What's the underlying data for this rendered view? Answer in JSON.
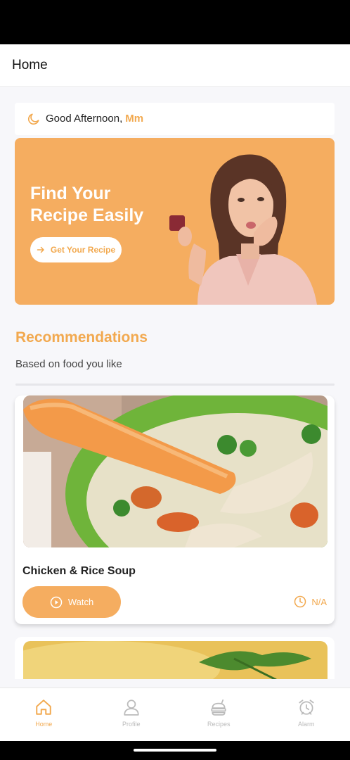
{
  "header": {
    "title": "Home"
  },
  "greeting": {
    "text": "Good Afternoon,",
    "name": "Mm"
  },
  "banner": {
    "title": "Find Your\n Recipe Easily",
    "button_label": "Get Your Recipe"
  },
  "recommendations": {
    "title": "Recommendations",
    "subtitle": "Based on food you like"
  },
  "recipes": [
    {
      "name": "Chicken & Rice Soup",
      "watch_label": "Watch",
      "time": "N/A"
    }
  ],
  "nav": [
    {
      "label": "Home",
      "icon": "home-icon",
      "active": true
    },
    {
      "label": "Profile",
      "icon": "profile-icon",
      "active": false
    },
    {
      "label": "Recipes",
      "icon": "recipes-icon",
      "active": false
    },
    {
      "label": "Alarm",
      "icon": "alarm-icon",
      "active": false
    }
  ],
  "colors": {
    "accent": "#f2a94f",
    "banner": "#f5ad60",
    "background": "#f7f7fa"
  }
}
